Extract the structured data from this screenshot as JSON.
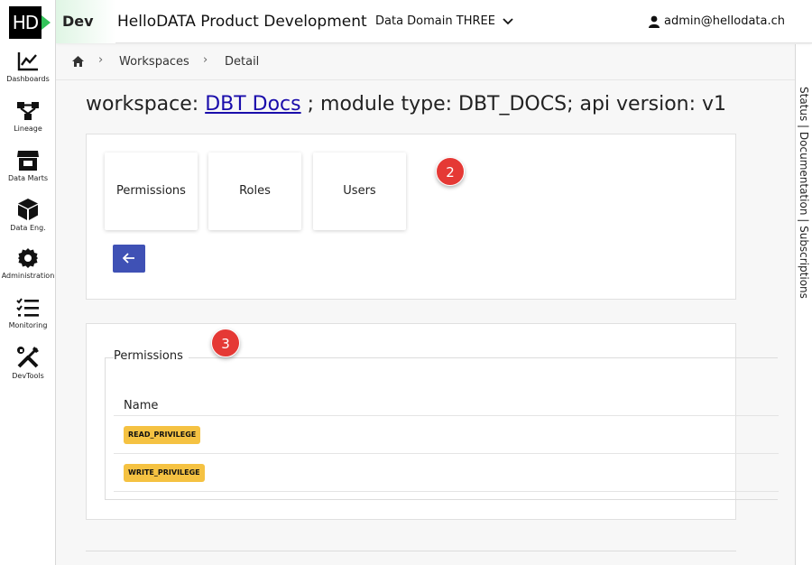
{
  "sidebar": {
    "logo_text": "HD",
    "items": [
      {
        "label": "Dashboards",
        "icon": "chart-line-icon"
      },
      {
        "label": "Lineage",
        "icon": "lineage-icon"
      },
      {
        "label": "Data Marts",
        "icon": "store-icon"
      },
      {
        "label": "Data Eng.",
        "icon": "cube-icon"
      },
      {
        "label": "Administration",
        "icon": "gear-icon"
      },
      {
        "label": "Monitoring",
        "icon": "checklist-icon"
      },
      {
        "label": "DevTools",
        "icon": "tools-icon"
      }
    ]
  },
  "header": {
    "env": "Dev",
    "title": "HelloDATA Product Development",
    "domain": "Data Domain THREE",
    "user": "admin@hellodata.ch"
  },
  "breadcrumb": {
    "items": [
      "Workspaces",
      "Detail"
    ]
  },
  "right_panel": {
    "text": "Status | Documentation | Subscriptions"
  },
  "page": {
    "title_prefix": "workspace: ",
    "workspace_link": "DBT Docs",
    "title_suffix": " ; module type: DBT_DOCS; api version: v1"
  },
  "tiles": [
    "Permissions",
    "Roles",
    "Users"
  ],
  "annotations": [
    "2",
    "3"
  ],
  "permissions": {
    "legend": "Permissions",
    "column": "Name",
    "rows": [
      "READ_PRIVILEGE",
      "WRITE_PRIVILEGE"
    ]
  },
  "colors": {
    "accent": "#3f51b5",
    "badge": "#f5c242",
    "marker": "#e53935",
    "logo_green": "#33c35a"
  }
}
